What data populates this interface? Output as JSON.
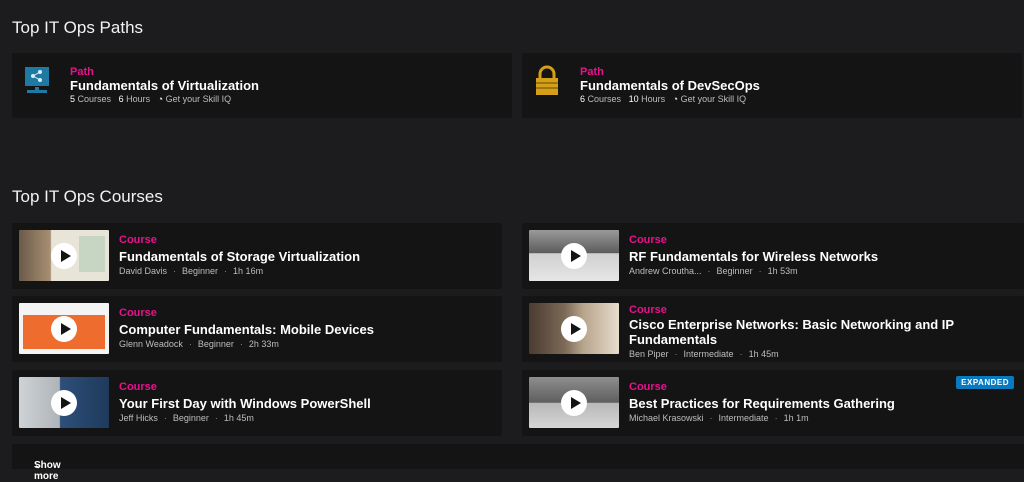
{
  "paths_section": {
    "title": "Top IT Ops Paths",
    "items": [
      {
        "kind": "Path",
        "title": "Fundamentals of Virtualization",
        "courses_count": "5",
        "courses_label": "Courses",
        "hours_count": "6",
        "hours_label": "Hours",
        "skill_iq": "Get your Skill IQ",
        "icon": "server-network-icon"
      },
      {
        "kind": "Path",
        "title": "Fundamentals of DevSecOps",
        "courses_count": "6",
        "courses_label": "Courses",
        "hours_count": "10",
        "hours_label": "Hours",
        "skill_iq": "Get your Skill IQ",
        "icon": "padlock-icon"
      }
    ]
  },
  "courses_section": {
    "title": "Top IT Ops Courses",
    "items": [
      {
        "kind": "Course",
        "title": "Fundamentals of Storage Virtualization",
        "author": "David Davis",
        "level": "Beginner",
        "duration": "1h 16m"
      },
      {
        "kind": "Course",
        "title": "RF Fundamentals for Wireless Networks",
        "author": "Andrew Croutha...",
        "level": "Beginner",
        "duration": "1h 53m"
      },
      {
        "kind": "Course",
        "title": "Computer Fundamentals: Mobile Devices",
        "author": "Glenn Weadock",
        "level": "Beginner",
        "duration": "2h 33m"
      },
      {
        "kind": "Course",
        "title": "Cisco Enterprise Networks: Basic Networking and IP Fundamentals",
        "author": "Ben Piper",
        "level": "Intermediate",
        "duration": "1h 45m"
      },
      {
        "kind": "Course",
        "title": "Your First Day with Windows PowerShell",
        "author": "Jeff Hicks",
        "level": "Beginner",
        "duration": "1h 45m"
      },
      {
        "kind": "Course",
        "title": "Best Practices for Requirements Gathering",
        "author": "Michael Krasowski",
        "level": "Intermediate",
        "duration": "1h 1m",
        "badge": "EXPANDED"
      }
    ],
    "show_more": "Show more"
  },
  "colors": {
    "accent": "#e8118d",
    "badge": "#0a7ac0",
    "background": "#1c1c1e",
    "card": "#141415"
  }
}
